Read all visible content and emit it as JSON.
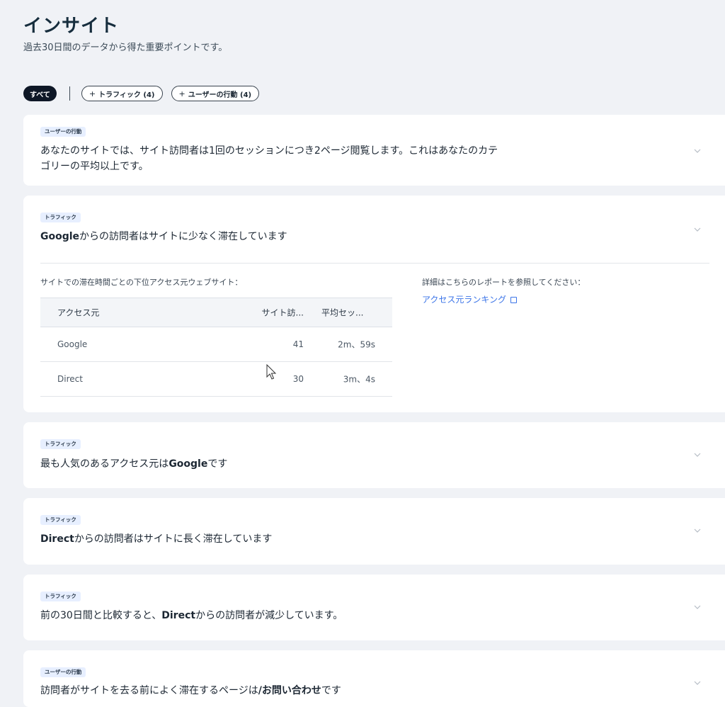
{
  "header": {
    "title": "インサイト",
    "subtitle": "過去30日間のデータから得た重要ポイントです。"
  },
  "filters": {
    "all": "すべて",
    "traffic": "トラフィック (4)",
    "behavior": "ユーザーの行動 (4)",
    "plus": "+"
  },
  "cards": [
    {
      "tag": "ユーザーの行動",
      "line1": "あなたのサイトでは、サイト訪問者は1回のセッションにつき2ページ閲覧します。これはあなたのカテ",
      "line2": "ゴリーの平均以上です。"
    },
    {
      "tag": "トラフィック",
      "text_bold": "Google",
      "text_rest": "からの訪問者はサイトに少なく滞在しています",
      "sources_label": "サイトでの滞在時間ごとの下位アクセス元ウェブサイト：",
      "report_label": "詳細はこちらのレポートを参照してください：",
      "report_link": "アクセス元ランキング",
      "table": {
        "headers": [
          "アクセス元",
          "サイト訪...",
          "平均セッ..."
        ],
        "rows": [
          [
            "Google",
            "41",
            "2m、59s"
          ],
          [
            "Direct",
            "30",
            "3m、4s"
          ]
        ]
      }
    },
    {
      "tag": "トラフィック",
      "text_pre": "最も人気のあるアクセス元は",
      "text_bold": "Google",
      "text_post": "です"
    },
    {
      "tag": "トラフィック",
      "text_bold": "Direct",
      "text_rest": "からの訪問者はサイトに長く滞在しています"
    },
    {
      "tag": "トラフィック",
      "text_pre": "前の30日間と比較すると、",
      "text_bold": "Direct",
      "text_post": "からの訪問者が減少しています。"
    },
    {
      "tag": "ユーザーの行動",
      "text_pre": "訪問者がサイトを去る前によく滞在するページは",
      "text_bold": "/お問い合わせ",
      "text_post": "です"
    }
  ],
  "colors": {
    "background": "#f0f2f6",
    "tag_bg": "#e7efff",
    "link": "#3b74e8",
    "active_chip": "#0e1726"
  }
}
